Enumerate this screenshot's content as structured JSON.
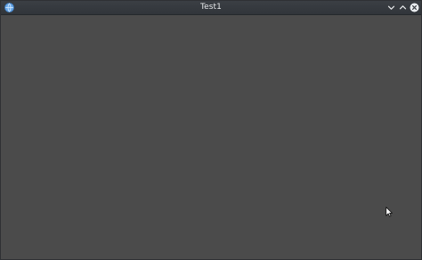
{
  "window": {
    "title": "Test1"
  },
  "titlebar": {
    "app_icon": "app-globe-icon",
    "controls": [
      {
        "name": "minimize",
        "icon": "chevron-down-icon"
      },
      {
        "name": "maximize",
        "icon": "chevron-up-icon"
      },
      {
        "name": "close",
        "icon": "close-circle-icon"
      }
    ]
  },
  "colors": {
    "titlebar": "#353a3f",
    "content": "#4b4b4b",
    "title_text": "#e6e8ea",
    "close_button": "#e9ecef"
  }
}
